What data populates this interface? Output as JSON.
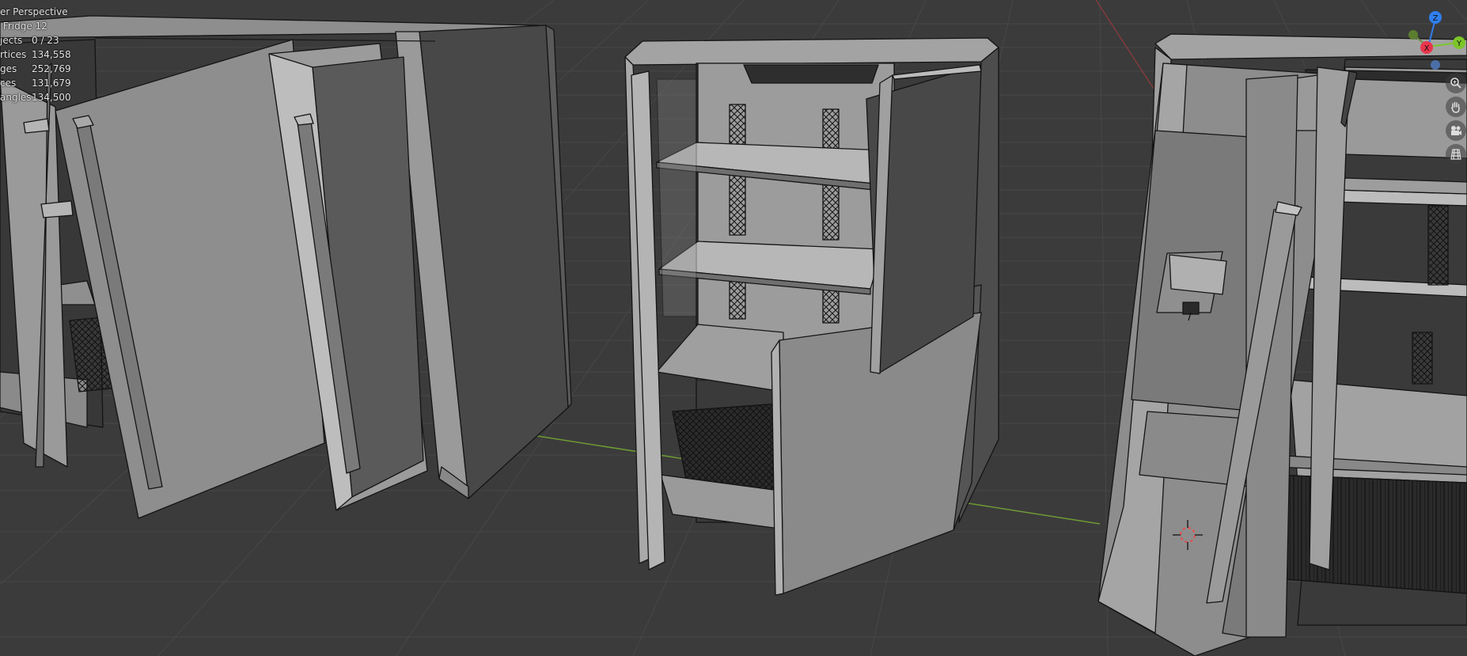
{
  "viewport": {
    "view_name": "er Perspective",
    "collection_object": "Fridge 12"
  },
  "stats": [
    {
      "label": "jects",
      "value": "0 / 23"
    },
    {
      "label": "rtices",
      "value": "134,558"
    },
    {
      "label": "ges",
      "value": "252,769"
    },
    {
      "label": "ces",
      "value": "131,679"
    },
    {
      "label": "angles",
      "value": "134,500"
    }
  ],
  "gizmo": {
    "axes": [
      {
        "label": "Z",
        "color": "#2f7ff0"
      },
      {
        "label": "Y",
        "color": "#7cc628"
      },
      {
        "label": "X",
        "color": "#e8364c"
      }
    ]
  },
  "nav_buttons": [
    {
      "icon": "zoom-icon"
    },
    {
      "icon": "hand-pan-icon"
    },
    {
      "icon": "camera-icon"
    },
    {
      "icon": "grid-perspective-icon"
    }
  ],
  "colors": {
    "background": "#3b3b3b",
    "grid_line": "#4a4a4a",
    "x_axis": "#c04040",
    "y_axis": "#7ea63a",
    "mesh_dark": "#4d4d4d",
    "mesh_light": "#a9a9a9"
  }
}
